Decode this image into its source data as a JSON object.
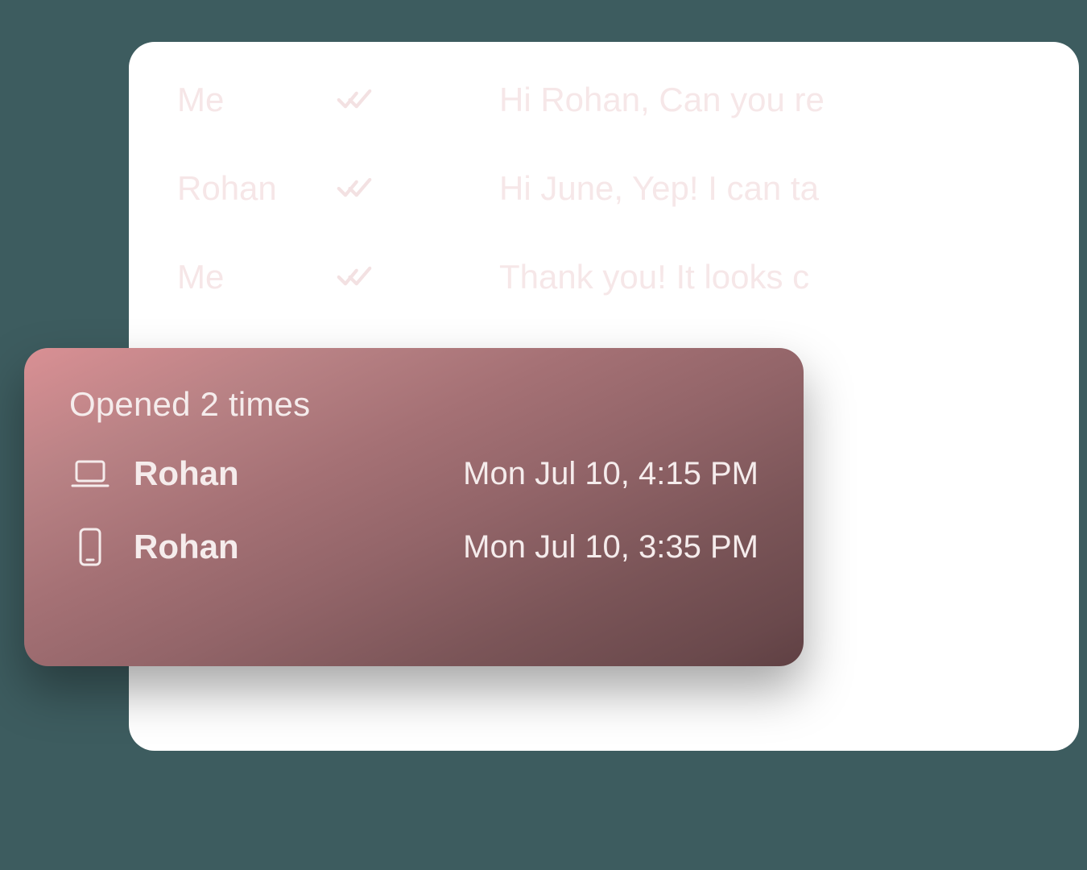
{
  "messages": [
    {
      "sender": "Me",
      "preview": "Hi Rohan, Can you re"
    },
    {
      "sender": "Rohan",
      "preview": "Hi June, Yep! I can ta"
    },
    {
      "sender": "Me",
      "preview": "Thank you! It looks c"
    }
  ],
  "popover": {
    "title": "Opened 2 times",
    "items": [
      {
        "device": "laptop",
        "name": "Rohan",
        "time": "Mon Jul 10, 4:15 PM"
      },
      {
        "device": "phone",
        "name": "Rohan",
        "time": "Mon Jul 10, 3:35 PM"
      }
    ]
  }
}
